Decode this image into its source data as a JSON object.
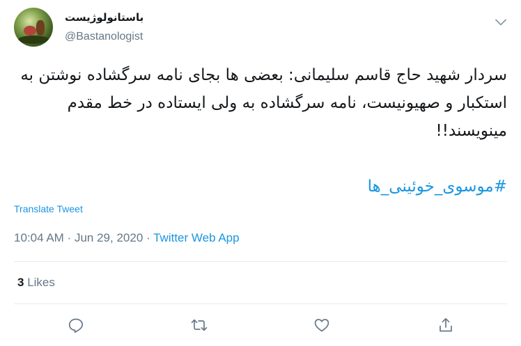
{
  "author": {
    "display_name": "باستانولوژیست",
    "handle": "@Bastanologist"
  },
  "tweet": {
    "text": "سردار شهید حاج قاسم سلیمانی: بعضی ها بجای نامه سرگشاده نوشتن به استکبار و صهیونیست، نامه سرگشاده به ولی ایستاده در خط مقدم مینویسند!!",
    "hashtag": "#موسوی_خوئینی_ها",
    "translate_label": "Translate Tweet",
    "time": "10:04 AM",
    "separator": "·",
    "date": "Jun 29, 2020",
    "source": "Twitter Web App"
  },
  "stats": {
    "likes_count": "3",
    "likes_label": "Likes"
  },
  "icons": {
    "caret": "chevron-down-icon",
    "reply": "reply-icon",
    "retweet": "retweet-icon",
    "like": "heart-icon",
    "share": "share-icon"
  },
  "colors": {
    "link": "#1b95e0",
    "muted": "#657786",
    "text": "#14171a",
    "divider": "#e6ecf0"
  }
}
